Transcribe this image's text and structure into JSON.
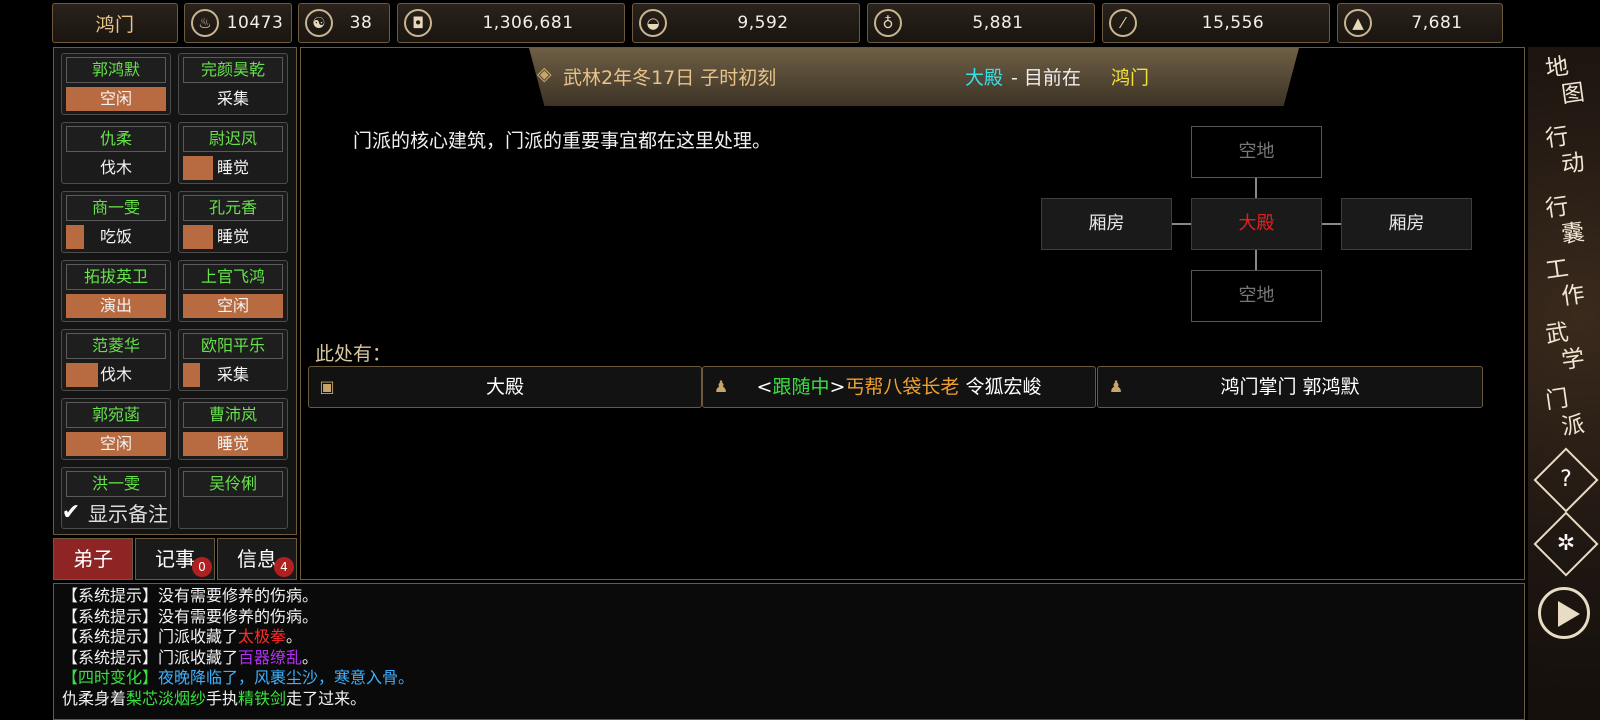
{
  "topbar": {
    "sect_name": "鸿门",
    "stats": [
      {
        "icon": "tea-icon",
        "value": "10473"
      },
      {
        "icon": "yin-yang-icon",
        "value": "38"
      },
      {
        "icon": "coin-icon",
        "value": "1,306,681"
      },
      {
        "icon": "food-bowl-icon",
        "value": "9,592"
      },
      {
        "icon": "gourd-icon",
        "value": "5,881"
      },
      {
        "icon": "wood-icon",
        "value": "15,556"
      },
      {
        "icon": "ore-icon",
        "value": "7,681"
      }
    ]
  },
  "disciples": [
    {
      "name": "郭鸿默",
      "status": "空闲",
      "progress": 1.0
    },
    {
      "name": "完颜昊乾",
      "status": "采集",
      "progress": 0
    },
    {
      "name": "仇柔",
      "status": "伐木",
      "progress": 0
    },
    {
      "name": "尉迟凤",
      "status": "睡觉",
      "progress": 0.3
    },
    {
      "name": "商一雯",
      "status": "吃饭",
      "progress": 0.18
    },
    {
      "name": "孔元香",
      "status": "睡觉",
      "progress": 0.3
    },
    {
      "name": "拓拔英卫",
      "status": "演出",
      "progress": 1.0
    },
    {
      "name": "上官飞鸿",
      "status": "空闲",
      "progress": 1.0
    },
    {
      "name": "范菱华",
      "status": "伐木",
      "progress": 0.32
    },
    {
      "name": "欧阳平乐",
      "status": "采集",
      "progress": 0.17
    },
    {
      "name": "郭宛菡",
      "status": "空闲",
      "progress": 1.0
    },
    {
      "name": "曹沛岚",
      "status": "睡觉",
      "progress": 1.0
    },
    {
      "name": "洪一雯",
      "status": "",
      "progress": 0
    },
    {
      "name": "吴伶俐",
      "status": "",
      "progress": 0
    }
  ],
  "show_notes_label": "显示备注",
  "tabs": [
    {
      "label": "弟子",
      "badge": ""
    },
    {
      "label": "记事",
      "badge": "0"
    },
    {
      "label": "信息",
      "badge": "4"
    }
  ],
  "header": {
    "date": "武林2年冬17日 子时初刻",
    "location": "大殿",
    "sep": " - 目前在",
    "place": "鸿门"
  },
  "description": "门派的核心建筑，门派的重要事宜都在这里处理。",
  "rooms": {
    "north": "空地",
    "west": "厢房",
    "center": "大殿",
    "east": "厢房",
    "south": "空地"
  },
  "here_label": "此处有：",
  "entities": [
    {
      "icon": "box-icon",
      "prefix": "",
      "tag": "",
      "title": "",
      "name": "大殿"
    },
    {
      "icon": "person-icon",
      "prefix": "<",
      "tag": "跟随中",
      "suffix": ">",
      "title": "丐帮八袋长老",
      "name": "令狐宏峻"
    },
    {
      "icon": "person-icon",
      "prefix": "",
      "tag": "",
      "title": "",
      "name": "鸿门掌门 郭鸿默"
    }
  ],
  "side_menu": [
    {
      "c1": "地",
      "c2": "图"
    },
    {
      "c1": "行",
      "c2": "动"
    },
    {
      "c1": "行",
      "c2": "囊"
    },
    {
      "c1": "工",
      "c2": "作"
    },
    {
      "c1": "武",
      "c2": "学"
    },
    {
      "c1": "门",
      "c2": "派"
    }
  ],
  "help_symbol": "?",
  "log": [
    {
      "parts": [
        {
          "t": "【系统提示】没有需要修养的伤病。",
          "c": ""
        }
      ]
    },
    {
      "parts": [
        {
          "t": "【系统提示】没有需要修养的伤病。",
          "c": ""
        }
      ]
    },
    {
      "parts": [
        {
          "t": "【系统提示】门派收藏了",
          "c": ""
        },
        {
          "t": "太极拳",
          "c": "red"
        },
        {
          "t": "。",
          "c": ""
        }
      ]
    },
    {
      "parts": [
        {
          "t": "【系统提示】门派收藏了",
          "c": ""
        },
        {
          "t": "百器缭乱",
          "c": "purple"
        },
        {
          "t": "。",
          "c": ""
        }
      ]
    },
    {
      "parts": [
        {
          "t": "【四时变化】",
          "c": "green"
        },
        {
          "t": "夜晚降临了，风裹尘沙，寒意入骨。",
          "c": "cyan"
        }
      ]
    },
    {
      "parts": [
        {
          "t": "仇柔身着",
          "c": ""
        },
        {
          "t": "梨芯淡烟纱",
          "c": "green"
        },
        {
          "t": "手执",
          "c": ""
        },
        {
          "t": "精铁剑",
          "c": "green"
        },
        {
          "t": "走了过来。",
          "c": ""
        }
      ]
    }
  ],
  "colors": {
    "name_green": "#66e24a",
    "busy_bar": "#b86a40",
    "gold": "#e8c38a",
    "active_tab": "#8f2424"
  }
}
